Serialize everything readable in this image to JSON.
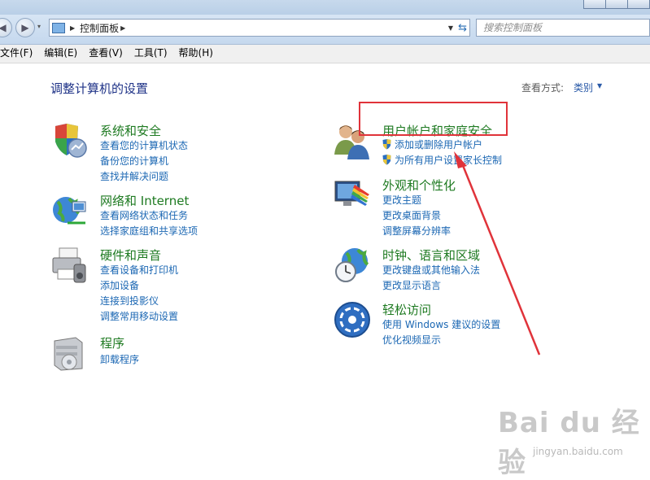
{
  "search": {
    "placeholder": "搜索控制面板"
  },
  "address": {
    "path": "控制面板"
  },
  "menu": [
    "文件(F)",
    "编辑(E)",
    "查看(V)",
    "工具(T)",
    "帮助(H)"
  ],
  "page_title": "调整计算机的设置",
  "view_by": {
    "label": "查看方式:",
    "value": "类别"
  },
  "categories": {
    "system": {
      "title": "系统和安全",
      "links": [
        "查看您的计算机状态",
        "备份您的计算机",
        "查找并解决问题"
      ]
    },
    "network": {
      "title": "网络和 Internet",
      "links": [
        "查看网络状态和任务",
        "选择家庭组和共享选项"
      ]
    },
    "hardware": {
      "title": "硬件和声音",
      "links": [
        "查看设备和打印机",
        "添加设备",
        "连接到投影仪",
        "调整常用移动设置"
      ]
    },
    "programs": {
      "title": "程序",
      "links": [
        "卸载程序"
      ]
    },
    "users": {
      "title": "用户帐户和家庭安全",
      "links": [
        "添加或删除用户帐户",
        "为所有用户设置家长控制"
      ]
    },
    "appearance": {
      "title": "外观和个性化",
      "links": [
        "更改主题",
        "更改桌面背景",
        "调整屏幕分辨率"
      ]
    },
    "clock": {
      "title": "时钟、语言和区域",
      "links": [
        "更改键盘或其他输入法",
        "更改显示语言"
      ]
    },
    "ease": {
      "title": "轻松访问",
      "links": [
        "使用 Windows 建议的设置",
        "优化视频显示"
      ]
    }
  },
  "watermark": {
    "logo": "Bai du 经验",
    "url": "jingyan.baidu.com"
  },
  "colors": {
    "accent_green": "#1e7a21",
    "link_blue": "#1b67b3",
    "annotation_red": "#e0333a"
  }
}
